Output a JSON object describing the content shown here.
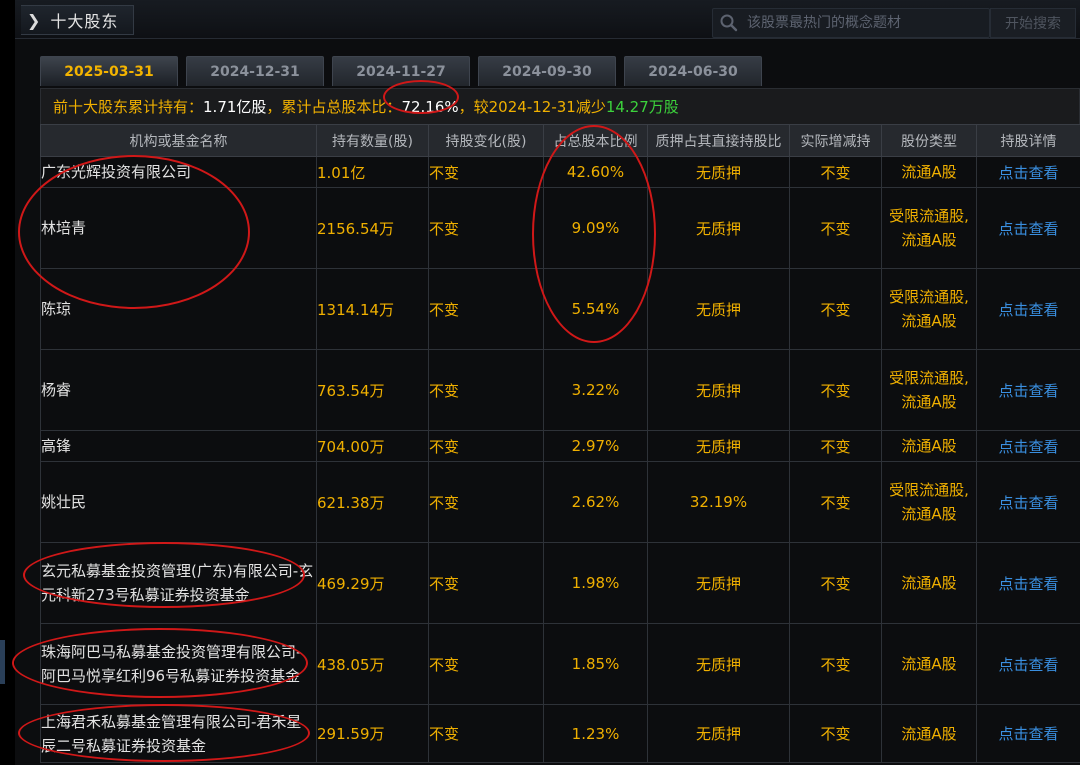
{
  "header": {
    "title": "十大股东",
    "search_placeholder": "该股票最热门的概念题材",
    "search_button": "开始搜索"
  },
  "tabs": [
    "2025-03-31",
    "2024-12-31",
    "2024-11-27",
    "2024-09-30",
    "2024-06-30"
  ],
  "active_tab": 0,
  "summary": {
    "label1": "前十大股东累计持有：",
    "total_held": "1.71亿股",
    "label2": "，累计占总股本比：",
    "ratio": "72.16%",
    "label3": "，较2024-12-31减少",
    "decrease": "14.27万股"
  },
  "table": {
    "columns": [
      "机构或基金名称",
      "持有数量(股)",
      "持股变化(股)",
      "占总股本比例",
      "质押占其直接持股比",
      "实际增减持",
      "股份类型",
      "持股详情"
    ],
    "rows": [
      {
        "name": "广东光辉投资有限公司",
        "amount": "1.01亿",
        "change": "不变",
        "ratio": "42.60%",
        "pledge": "无质押",
        "actual": "不变",
        "type": "流通A股",
        "detail": "点击查看"
      },
      {
        "name": "林培青",
        "amount": "2156.54万",
        "change": "不变",
        "ratio": "9.09%",
        "pledge": "无质押",
        "actual": "不变",
        "type": "受限流通股,流通A股",
        "detail": "点击查看"
      },
      {
        "name": "陈琼",
        "amount": "1314.14万",
        "change": "不变",
        "ratio": "5.54%",
        "pledge": "无质押",
        "actual": "不变",
        "type": "受限流通股,流通A股",
        "detail": "点击查看"
      },
      {
        "name": "杨睿",
        "amount": "763.54万",
        "change": "不变",
        "ratio": "3.22%",
        "pledge": "无质押",
        "actual": "不变",
        "type": "受限流通股,流通A股",
        "detail": "点击查看"
      },
      {
        "name": "高锋",
        "amount": "704.00万",
        "change": "不变",
        "ratio": "2.97%",
        "pledge": "无质押",
        "actual": "不变",
        "type": "流通A股",
        "detail": "点击查看"
      },
      {
        "name": "姚壮民",
        "amount": "621.38万",
        "change": "不变",
        "ratio": "2.62%",
        "pledge": "32.19%",
        "actual": "不变",
        "type": "受限流通股,流通A股",
        "detail": "点击查看"
      },
      {
        "name": "玄元私募基金投资管理(广东)有限公司-玄元科新273号私募证券投资基金",
        "amount": "469.29万",
        "change": "不变",
        "ratio": "1.98%",
        "pledge": "无质押",
        "actual": "不变",
        "type": "流通A股",
        "detail": "点击查看"
      },
      {
        "name": "珠海阿巴马私募基金投资管理有限公司-阿巴马悦享红利96号私募证券投资基金",
        "amount": "438.05万",
        "change": "不变",
        "ratio": "1.85%",
        "pledge": "无质押",
        "actual": "不变",
        "type": "流通A股",
        "detail": "点击查看"
      },
      {
        "name": "上海君禾私募基金管理有限公司-君禾星辰二号私募证券投资基金",
        "amount": "291.59万",
        "change": "不变",
        "ratio": "1.23%",
        "pledge": "无质押",
        "actual": "不变",
        "type": "流通A股",
        "detail": "点击查看"
      }
    ]
  },
  "colors": {
    "accent_yellow": "#f0b000",
    "link_blue": "#3a8fe0",
    "decrease_green": "#3cd23c",
    "annotation_red": "#d01818"
  }
}
